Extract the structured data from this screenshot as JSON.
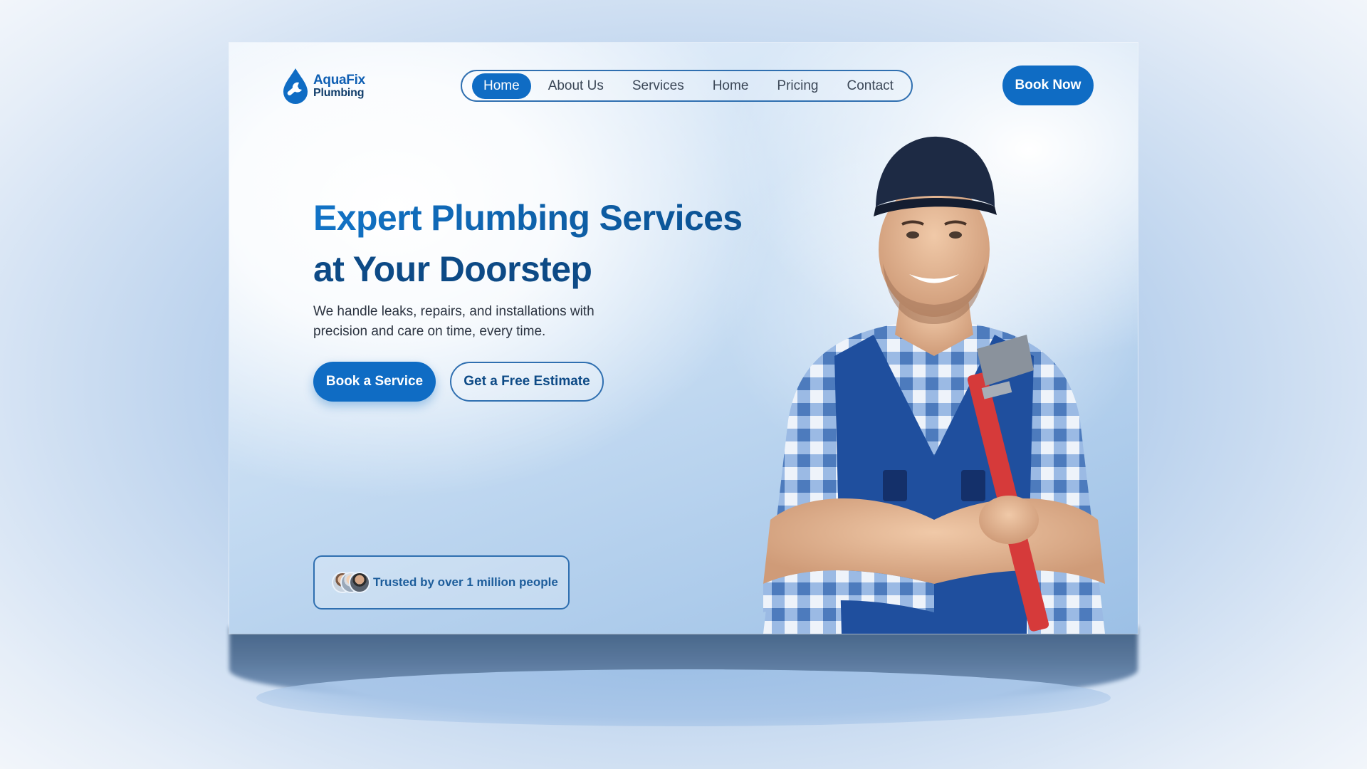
{
  "brand": {
    "name": "AquaFix",
    "sub": "Plumbing"
  },
  "nav": {
    "items": [
      {
        "label": "Home",
        "active": true
      },
      {
        "label": "About Us",
        "active": false
      },
      {
        "label": "Services",
        "active": false
      },
      {
        "label": "Home",
        "active": false
      },
      {
        "label": "Pricing",
        "active": false
      },
      {
        "label": "Contact",
        "active": false
      }
    ],
    "cta_label": "Book Now"
  },
  "hero": {
    "headline_line1": "Expert Plumbing Services",
    "headline_line2": "at Your Doorstep",
    "subtext_line1": "We handle leaks, repairs, and installations with",
    "subtext_line2": "precision and care on time, every time.",
    "primary_cta": "Book a Service",
    "secondary_cta": "Get a Free Estimate",
    "image_icon": "plumber-with-wrench-photo"
  },
  "trust": {
    "text": "Trusted by over 1 million people",
    "avatar_icon": "customer-avatars-icon"
  },
  "colors": {
    "primary": "#0f6cc4",
    "heading_dark": "#0d4a86",
    "outline": "#2f6fb0",
    "body_text": "#2b3340"
  }
}
